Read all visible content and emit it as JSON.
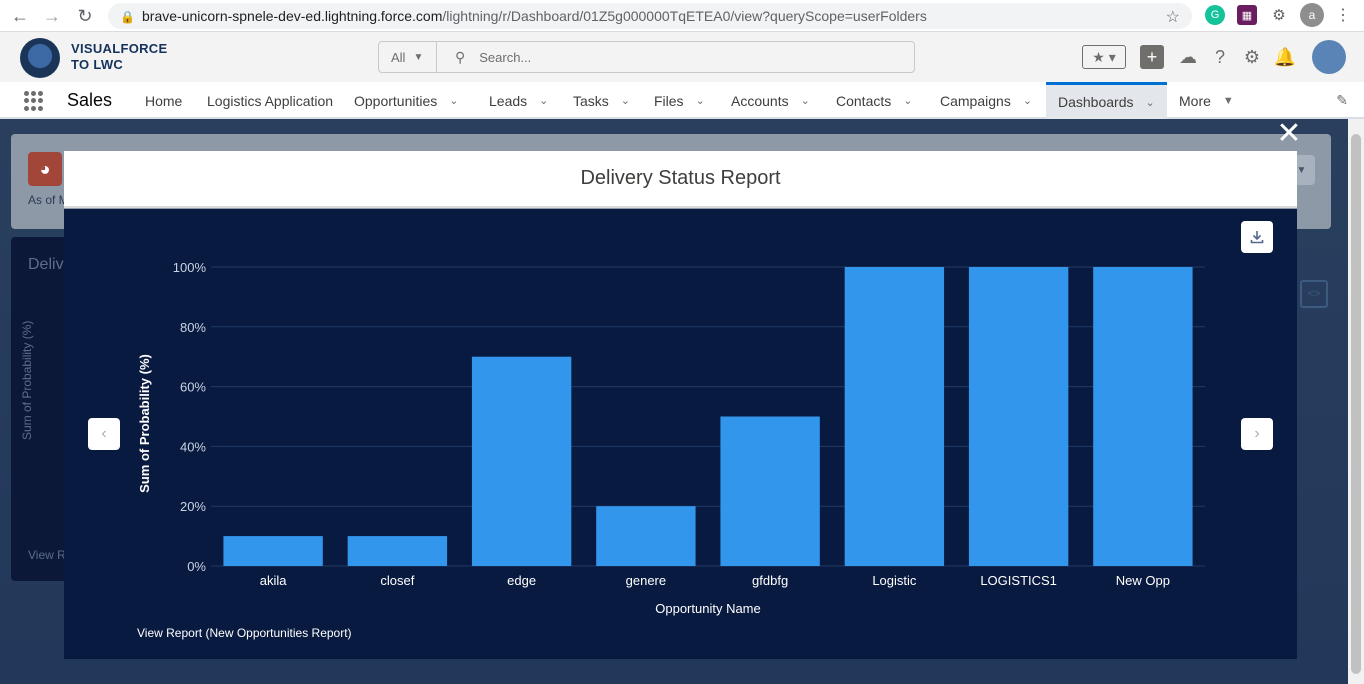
{
  "browser": {
    "url_host": "brave-unicorn-spnele-dev-ed.lightning.force.com",
    "url_path": "/lightning/r/Dashboard/01Z5g000000TqETEA0/view?queryScope=userFolders",
    "profile_initial": "a"
  },
  "header": {
    "brand_line1": "VISUALFORCE",
    "brand_line2": "TO LWC",
    "search_scope": "All",
    "search_placeholder": "Search...",
    "help_glyph": "?"
  },
  "nav": {
    "app_name": "Sales",
    "tabs": [
      {
        "label": "Home",
        "dropdown": false
      },
      {
        "label": "Logistics Application",
        "dropdown": false
      },
      {
        "label": "Opportunities",
        "dropdown": true
      },
      {
        "label": "Leads",
        "dropdown": true
      },
      {
        "label": "Tasks",
        "dropdown": true
      },
      {
        "label": "Files",
        "dropdown": true
      },
      {
        "label": "Accounts",
        "dropdown": true
      },
      {
        "label": "Contacts",
        "dropdown": true
      },
      {
        "label": "Campaigns",
        "dropdown": true
      },
      {
        "label": "Dashboards",
        "dropdown": true,
        "active": true
      },
      {
        "label": "More",
        "dropdown": true
      }
    ]
  },
  "background": {
    "as_of": "As of M",
    "panel_title": "Deliv",
    "ylabel": "Sum of Probability (%)",
    "view_link": "View R"
  },
  "modal": {
    "title": "Delivery Status Report",
    "view_report": "View Report (New Opportunities Report)"
  },
  "colors": {
    "chart_bg": "#091a40",
    "bar": "#3296ed",
    "accent": "#0070d2"
  },
  "chart_data": {
    "type": "bar",
    "categories": [
      "akila",
      "closef",
      "edge",
      "genere",
      "gfdbfg",
      "Logistic",
      "LOGISTICS1",
      "New Opp"
    ],
    "values": [
      10,
      10,
      70,
      20,
      50,
      100,
      100,
      100
    ],
    "xlabel": "Opportunity Name",
    "ylabel": "Sum of Probability (%)",
    "ylim": [
      0,
      100
    ],
    "yticks": [
      "0%",
      "20%",
      "40%",
      "60%",
      "80%",
      "100%"
    ],
    "grid": true
  }
}
